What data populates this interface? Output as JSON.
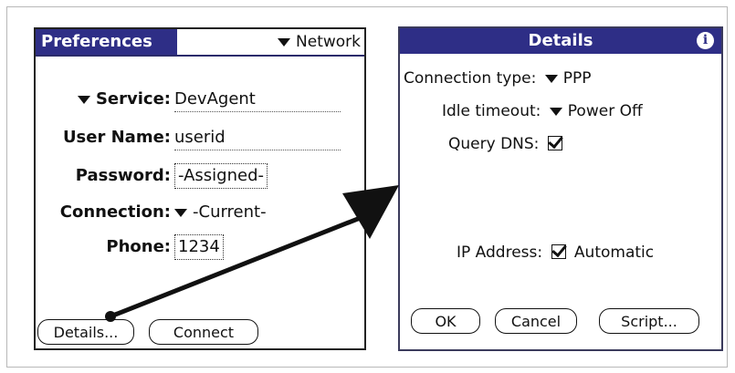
{
  "prefs": {
    "app_title": "Preferences",
    "category": "Network",
    "fields": {
      "service_label": "Service:",
      "service_value": "DevAgent",
      "username_label": "User Name:",
      "username_value": "userid",
      "password_label": "Password:",
      "password_value": "-Assigned-",
      "connection_label": "Connection:",
      "connection_value": "-Current-",
      "phone_label": "Phone:",
      "phone_value": "1234"
    },
    "buttons": {
      "details": "Details...",
      "connect": "Connect"
    }
  },
  "details": {
    "title": "Details",
    "connection_type_label": "Connection type:",
    "connection_type_value": "PPP",
    "idle_timeout_label": "Idle timeout:",
    "idle_timeout_value": "Power Off",
    "query_dns_label": "Query DNS:",
    "query_dns_checked": true,
    "ip_address_label": "IP Address:",
    "ip_address_value": "Automatic",
    "ip_address_checked": true,
    "buttons": {
      "ok": "OK",
      "cancel": "Cancel",
      "script": "Script..."
    }
  }
}
